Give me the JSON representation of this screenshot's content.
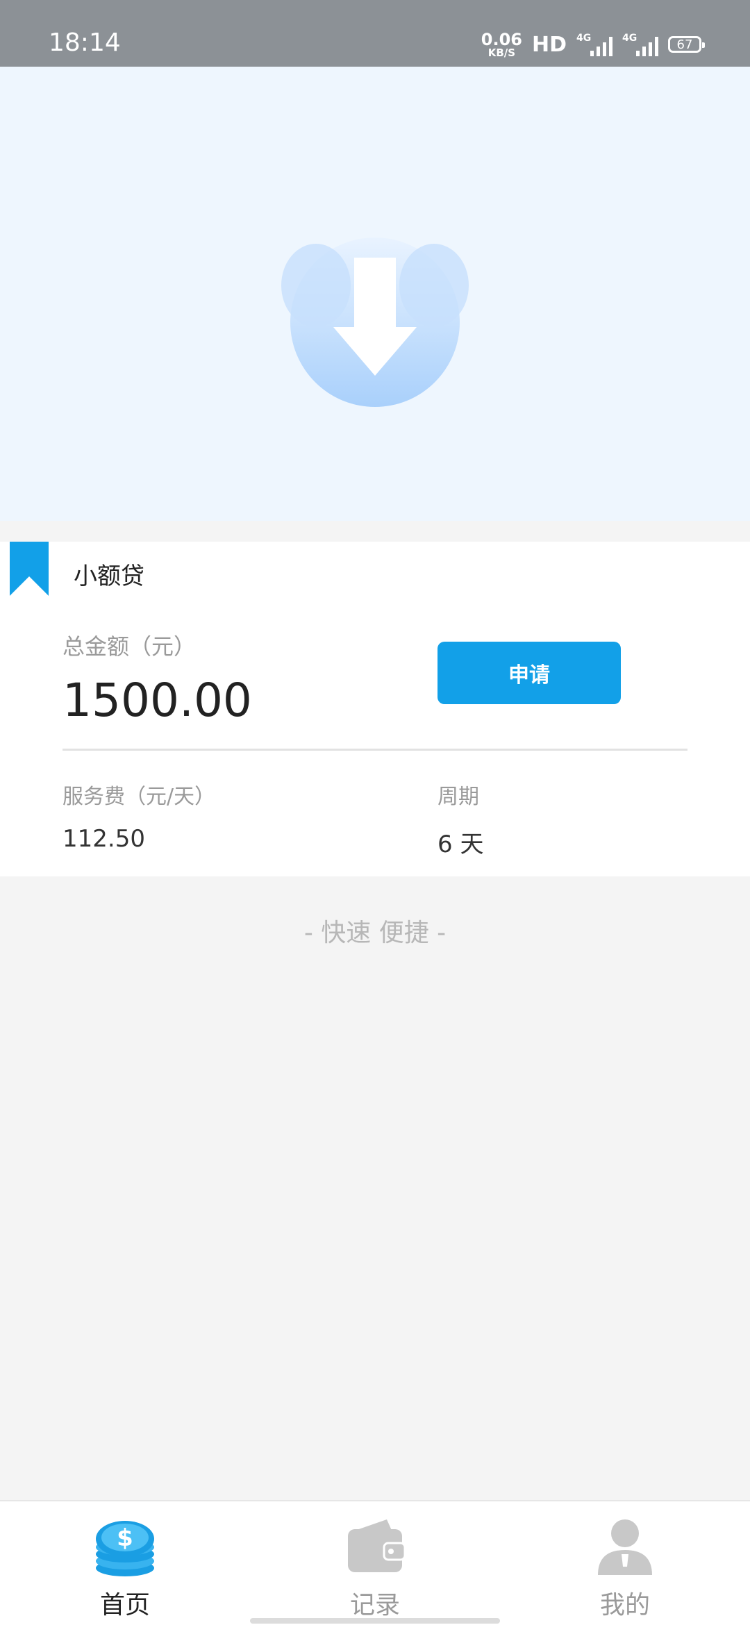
{
  "status_bar": {
    "time": "18:14",
    "net_speed_value": "0.06",
    "net_speed_unit": "KB/S",
    "hd_label": "HD",
    "signal1_label": "4G",
    "signal2_label": "4G",
    "battery": "67"
  },
  "banner": {
    "icon": "download-arrow-icon",
    "indicator_count": 1
  },
  "loan_card": {
    "title": "小额贷",
    "amount_label": "总金额（元）",
    "amount_value": "1500.00",
    "apply_button": "申请",
    "fee_label": "服务费（元/天）",
    "fee_value": "112.50",
    "period_label": "周期",
    "period_value": "6 天"
  },
  "slogan": "- 快速 便捷 -",
  "bottom_nav": {
    "items": [
      {
        "label": "首页",
        "icon": "coins-icon",
        "active": true
      },
      {
        "label": "记录",
        "icon": "wallet-icon",
        "active": false
      },
      {
        "label": "我的",
        "icon": "user-icon",
        "active": false
      }
    ]
  },
  "colors": {
    "accent": "#12a0e8",
    "status_bar": "#8c9196",
    "banner_bg": "#eef6fe",
    "inactive_icon": "#c8c8c8"
  }
}
